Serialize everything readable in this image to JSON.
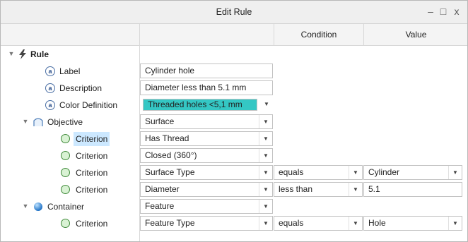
{
  "window": {
    "title": "Edit Rule",
    "minimize_glyph": "–",
    "maximize_glyph": "□",
    "close_glyph": "x"
  },
  "headers": {
    "condition": "Condition",
    "value": "Value"
  },
  "tree": {
    "rule": {
      "label": "Rule",
      "icon": "lightning-icon"
    },
    "label_attr": {
      "label": "Label",
      "value": "Cylinder hole"
    },
    "description_attr": {
      "label": "Description",
      "value": "Diameter less than 5.1 mm"
    },
    "color_attr": {
      "label": "Color Definition",
      "value": "Threaded holes <5,1 mm",
      "color": "#34c7c4"
    },
    "objective": {
      "label": "Objective",
      "value": "Surface",
      "icon": "surface-icon"
    },
    "criteria": [
      {
        "label": "Criterion",
        "value": "Has Thread"
      },
      {
        "label": "Criterion",
        "value": "Closed (360°)"
      },
      {
        "label": "Criterion",
        "value": "Surface Type",
        "condition": "equals",
        "cvalue": "Cylinder"
      },
      {
        "label": "Criterion",
        "value": "Diameter",
        "condition": "less than",
        "cvalue": "5.1"
      }
    ],
    "container": {
      "label": "Container",
      "value": "Feature",
      "icon": "sphere-icon"
    },
    "container_criterion": {
      "label": "Criterion",
      "value": "Feature Type",
      "condition": "equals",
      "cvalue": "Hole"
    }
  },
  "glyphs": {
    "attr": "a",
    "dropdown": "▼",
    "expand": "▼"
  }
}
